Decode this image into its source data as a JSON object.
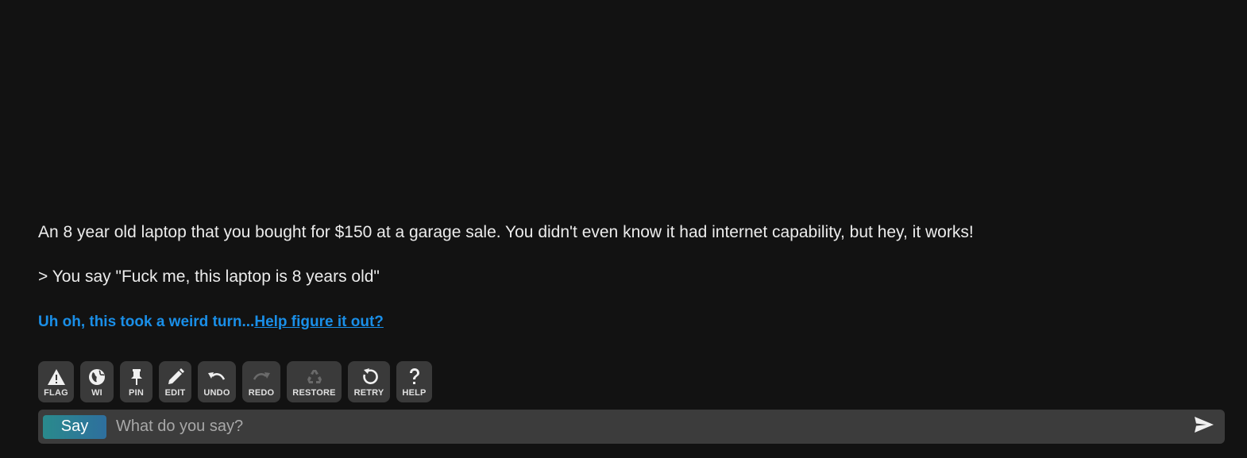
{
  "story": {
    "text": "An 8 year old laptop that you bought for $150 at a garage sale. You didn't even know it had internet capability, but hey, it works!",
    "action": "> You say \"Fuck me, this laptop is 8 years old\""
  },
  "notice": {
    "prefix": "Uh oh, this took a weird turn...",
    "link": "Help figure it out?"
  },
  "toolbar": {
    "buttons": [
      {
        "label": "FLAG",
        "icon": "warning-icon"
      },
      {
        "label": "WI",
        "icon": "globe-icon"
      },
      {
        "label": "PIN",
        "icon": "pin-icon"
      },
      {
        "label": "EDIT",
        "icon": "pencil-icon"
      },
      {
        "label": "UNDO",
        "icon": "undo-icon"
      },
      {
        "label": "REDO",
        "icon": "redo-icon",
        "disabled": true
      },
      {
        "label": "RESTORE",
        "icon": "recycle-icon",
        "disabled": true
      },
      {
        "label": "RETRY",
        "icon": "retry-icon"
      },
      {
        "label": "HELP",
        "icon": "question-icon"
      }
    ]
  },
  "input": {
    "mode_label": "Say",
    "placeholder": "What do you say?"
  },
  "colors": {
    "background": "#121212",
    "link": "#1a8fe8",
    "button_bg": "#3a3a3a",
    "input_bg": "#3c3c3c"
  }
}
